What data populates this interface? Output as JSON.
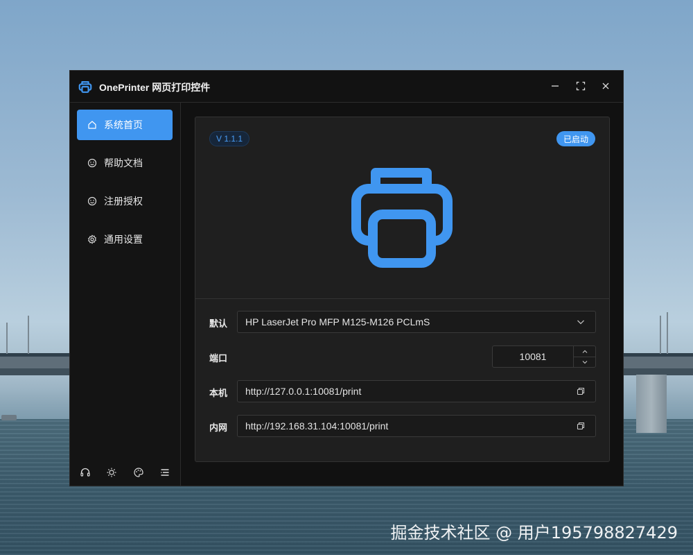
{
  "window": {
    "title": "OnePrinter 网页打印控件"
  },
  "sidebar": {
    "items": [
      {
        "label": "系统首页",
        "icon": "home-icon",
        "active": true
      },
      {
        "label": "帮助文档",
        "icon": "smile-icon",
        "active": false
      },
      {
        "label": "注册授权",
        "icon": "smile-icon",
        "active": false
      },
      {
        "label": "通用设置",
        "icon": "gear-icon",
        "active": false
      }
    ],
    "footer_icons": [
      "headset-icon",
      "sun-icon",
      "palette-icon",
      "list-icon"
    ]
  },
  "main": {
    "version": "V 1.1.1",
    "status": "已启动",
    "form": {
      "default_label": "默认",
      "default_printer": "HP LaserJet Pro MFP M125-M126 PCLmS",
      "port_label": "端口",
      "port_value": "10081",
      "local_label": "本机",
      "local_url": "http://127.0.0.1:10081/print",
      "lan_label": "内网",
      "lan_url": "http://192.168.31.104:10081/print"
    }
  },
  "colors": {
    "accent": "#4096f0",
    "window_bg": "#121212",
    "card_bg": "#1f1f1f"
  },
  "watermark": "掘金技术社区 @ 用户195798827429"
}
